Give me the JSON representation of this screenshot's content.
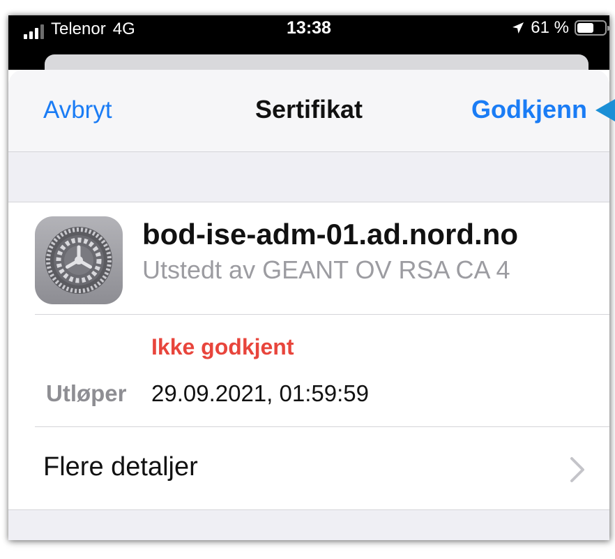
{
  "status_bar": {
    "carrier": "Telenor",
    "network": "4G",
    "time": "13:38",
    "battery": "61 %",
    "battery_level": 0.61,
    "location_icon": "location-arrow-icon"
  },
  "nav": {
    "cancel_label": "Avbryt",
    "title": "Sertifikat",
    "approve_label": "Godkjenn"
  },
  "certificate": {
    "icon": "settings-gear-icon",
    "name": "bod-ise-adm-01.ad.nord.no",
    "issuer": "Utstedt av GEANT OV RSA CA 4"
  },
  "status": {
    "trust_text": "Ikke godkjent",
    "expires_label": "Utløper",
    "expires_value": "29.09.2021, 01:59:59"
  },
  "details": {
    "label": "Flere detaljer",
    "chevron_icon": "chevron-right-icon"
  },
  "colors": {
    "accent": "#1a7cf5",
    "error": "#e8453c",
    "annotation_arrow": "#1b8fd6"
  }
}
